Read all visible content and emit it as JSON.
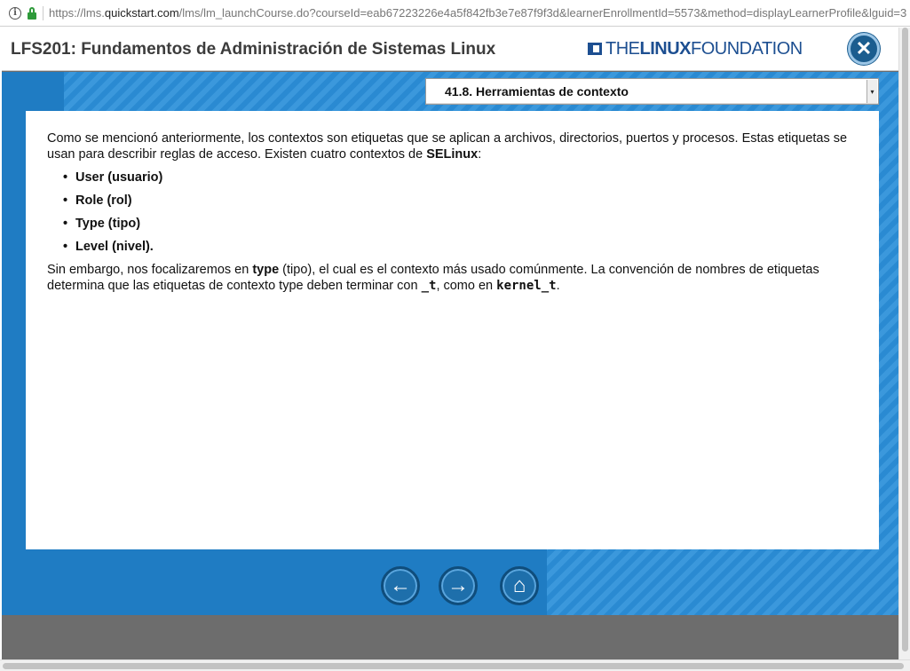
{
  "browser": {
    "url_prefix": "https://lms.",
    "url_host": "quickstart.com",
    "url_rest": "/lms/lm_launchCourse.do?courseId=eab67223226e4a5f842fb3e7e87f9f3d&learnerEnrollmentId=5573&method=displayLearnerProfile&lguid=3"
  },
  "header": {
    "title": "LFS201: Fundamentos de Administración de Sistemas Linux",
    "logo_the": "THE",
    "logo_linux": "LINUX",
    "logo_foundation": "FOUNDATION",
    "close_glyph": "✕"
  },
  "section_select": {
    "selected": "41.8. Herramientas de contexto",
    "arrow": "▾"
  },
  "content": {
    "p1_a": "Como se mencionó anteriormente, los contextos son etiquetas que se aplican a archivos, directorios, puertos y procesos. Estas etiquetas se usan para describir reglas de acceso. Existen cuatro contextos de ",
    "p1_b": "SELinux",
    "p1_c": ":",
    "bullets": [
      "User (usuario)",
      "Role (rol)",
      "Type (tipo)",
      "Level (nivel)."
    ],
    "p2_a": "Sin embargo, nos focalizaremos en ",
    "p2_b": "type",
    "p2_c": " (tipo), el cual es el contexto más usado comúnmente. La convención de nombres de etiquetas determina que las etiquetas de contexto type deben terminar con ",
    "p2_d": "_t",
    "p2_e": ", como en ",
    "p2_f": "kernel_t",
    "p2_g": "."
  },
  "nav": {
    "back_glyph": "←",
    "next_glyph": "→",
    "home_glyph": "⌂"
  },
  "colors": {
    "course_blue": "#2a8ad2",
    "dark_blue": "#1f7cc3",
    "logo_blue": "#1d4f91",
    "frame_gray": "#6d6d6d"
  }
}
